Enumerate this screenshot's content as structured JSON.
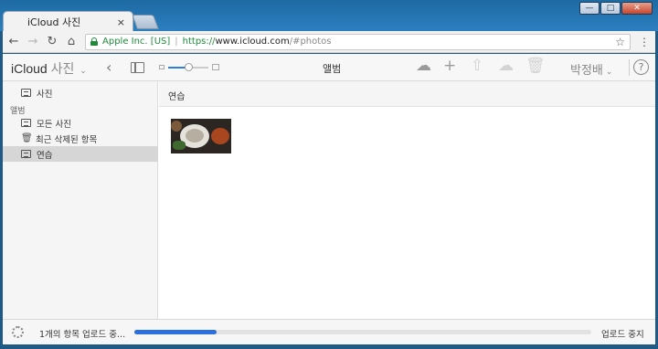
{
  "window": {
    "controls": {
      "minimize": "—",
      "maximize": "□",
      "close": "✕"
    }
  },
  "tab": {
    "title": "iCloud 사진",
    "close": "×"
  },
  "toolbar": {
    "back": "←",
    "forward": "→",
    "reload": "↻",
    "home": "⌂",
    "org_label": "Apple Inc. [US]",
    "separator": "|",
    "url_scheme": "https://",
    "url_host": "www.icloud.com",
    "url_path": "/#photos",
    "star": "☆",
    "menu": "⋮"
  },
  "app_header": {
    "brand": "iCloud",
    "app_name": "사진",
    "brand_chevron": "⌄",
    "back": "‹",
    "view_title": "앨범",
    "zoom_level": 0.5,
    "upload": "☁",
    "add": "+",
    "share": "⇧",
    "download": "☁",
    "trash": "🗑",
    "user_name": "박정배",
    "user_chevron": "⌄",
    "help": "?"
  },
  "sidebar": {
    "photos_label": "사진",
    "albums_heading": "앨범",
    "items": [
      {
        "label": "모든 사진",
        "icon": "grid-icon"
      },
      {
        "label": "최근 삭제된 항목",
        "icon": "trash-icon"
      },
      {
        "label": "연습",
        "icon": "grid-icon",
        "selected": true
      }
    ]
  },
  "content": {
    "title": "연습"
  },
  "status": {
    "text": "1개의 항목 업로드 중...",
    "progress": 0.18,
    "stop_label": "업로드 중지"
  }
}
